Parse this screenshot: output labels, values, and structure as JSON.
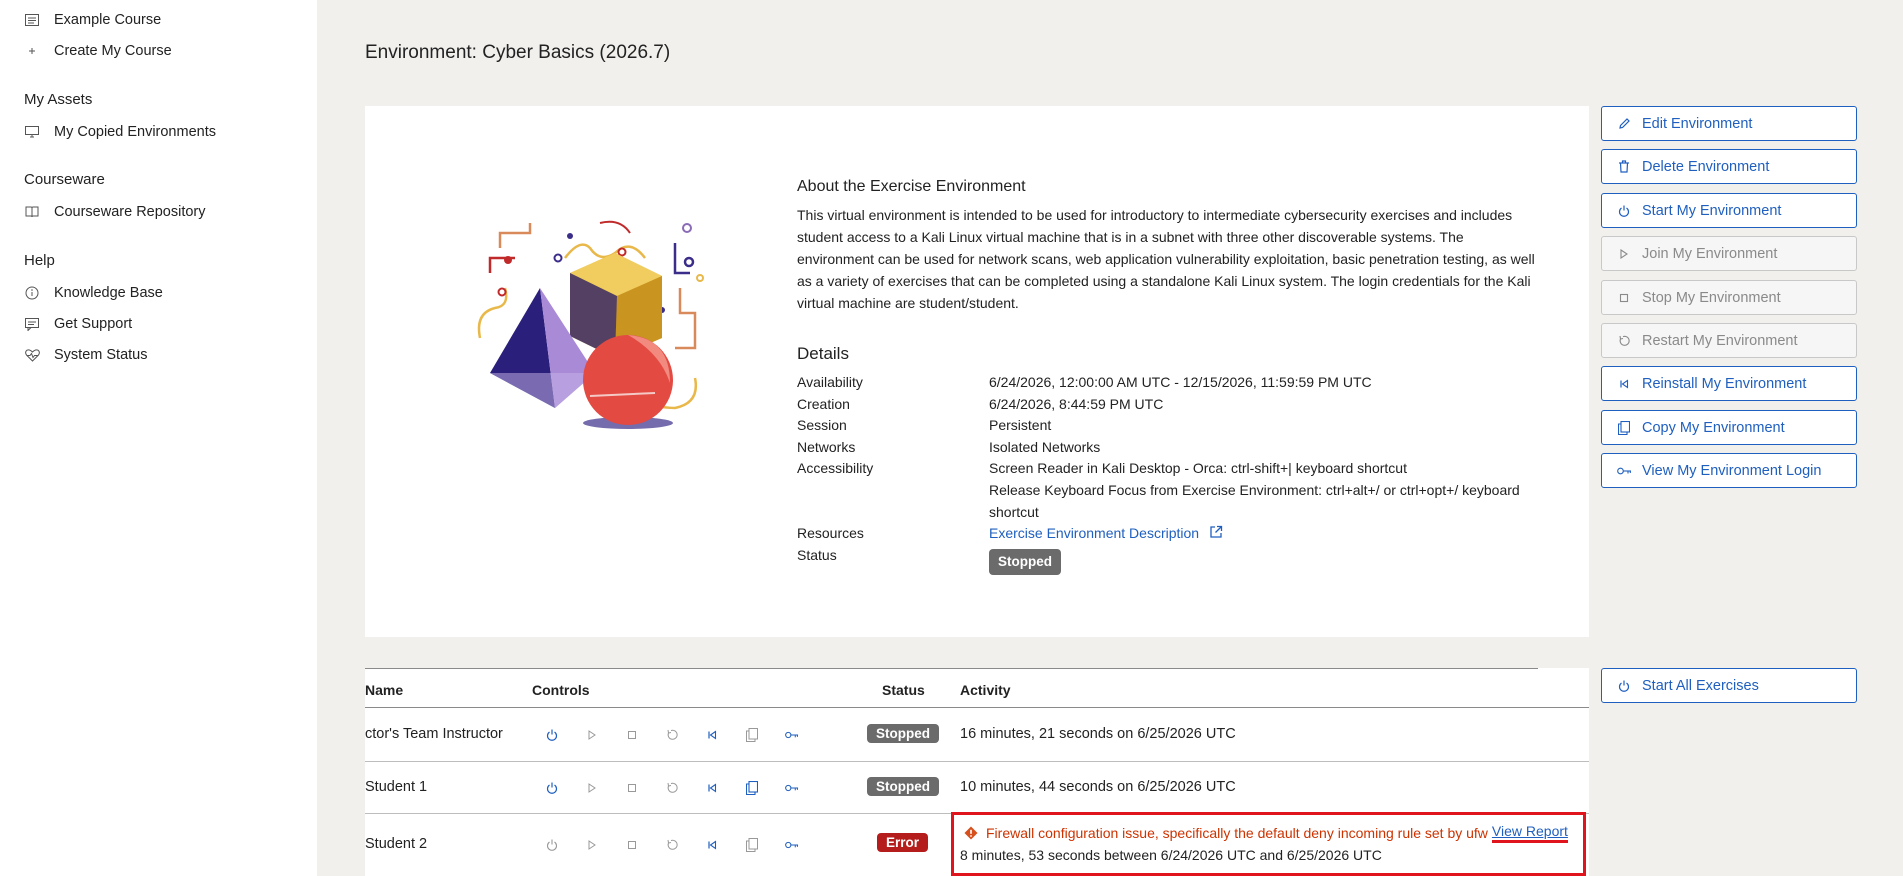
{
  "sidebar": {
    "items_top": [
      {
        "label": "Example Course",
        "icon": "list-icon"
      },
      {
        "label": "Create My Course",
        "icon": "plus-icon"
      }
    ],
    "sections": [
      {
        "heading": "My Assets",
        "items": [
          {
            "label": "My Copied Environments",
            "icon": "monitor-icon"
          }
        ]
      },
      {
        "heading": "Courseware",
        "items": [
          {
            "label": "Courseware Repository",
            "icon": "book-icon"
          }
        ]
      },
      {
        "heading": "Help",
        "items": [
          {
            "label": "Knowledge Base",
            "icon": "info-icon"
          },
          {
            "label": "Get Support",
            "icon": "chat-icon"
          },
          {
            "label": "System Status",
            "icon": "heart-pulse-icon"
          }
        ]
      }
    ]
  },
  "page": {
    "title": "Environment: Cyber Basics (2026.7)"
  },
  "about": {
    "title": "About the Exercise Environment",
    "text": "This virtual environment is intended to be used for introductory to intermediate cybersecurity exercises and includes student access to a Kali Linux virtual machine that is in a subnet with three other discoverable systems. The environment can be used for network scans, web application vulnerability exploitation, basic penetration testing, as well as a variety of exercises that can be completed using a standalone Kali Linux system. The login credentials for the Kali virtual machine are student/student."
  },
  "details": {
    "title": "Details",
    "availability_label": "Availability",
    "availability": "6/24/2026, 12:00:00 AM UTC - 12/15/2026, 11:59:59 PM UTC",
    "creation_label": "Creation",
    "creation": "6/24/2026, 8:44:59 PM UTC",
    "session_label": "Session",
    "session": "Persistent",
    "networks_label": "Networks",
    "networks": "Isolated Networks",
    "accessibility_label": "Accessibility",
    "accessibility_1": "Screen Reader in Kali Desktop - Orca: ctrl-shift+| keyboard shortcut",
    "accessibility_2": "Release Keyboard Focus from Exercise Environment: ctrl+alt+/ or ctrl+opt+/ keyboard shortcut",
    "resources_label": "Resources",
    "resources_link": "Exercise Environment Description",
    "status_label": "Status",
    "status": "Stopped"
  },
  "actions": [
    {
      "label": "Edit Environment",
      "icon": "pencil-icon",
      "enabled": true
    },
    {
      "label": "Delete Environment",
      "icon": "trash-icon",
      "enabled": true
    },
    {
      "label": "Start My Environment",
      "icon": "power-icon",
      "enabled": true
    },
    {
      "label": "Join My Environment",
      "icon": "play-icon",
      "enabled": false
    },
    {
      "label": "Stop My Environment",
      "icon": "stop-icon",
      "enabled": false
    },
    {
      "label": "Restart My Environment",
      "icon": "restart-icon",
      "enabled": false
    },
    {
      "label": "Reinstall My Environment",
      "icon": "skip-back-icon",
      "enabled": true
    },
    {
      "label": "Copy My Environment",
      "icon": "copy-icon",
      "enabled": true
    },
    {
      "label": "View My Environment Login",
      "icon": "key-icon",
      "enabled": true
    }
  ],
  "start_all": {
    "label": "Start All Exercises",
    "icon": "power-icon"
  },
  "table": {
    "headers": {
      "name": "Name",
      "controls": "Controls",
      "status": "Status",
      "activity": "Activity"
    },
    "rows": [
      {
        "name": "ctor's Team Instructor",
        "status": "Stopped",
        "activity": "16 minutes, 21 seconds on 6/25/2026 UTC"
      },
      {
        "name": "Student 1",
        "status": "Stopped",
        "activity": "10 minutes, 44 seconds on 6/25/2026 UTC"
      },
      {
        "name": "Student 2",
        "status": "Error",
        "error_message": "Firewall configuration issue, specifically the default deny incoming rule set by ufw",
        "error_link": "View Report",
        "activity": "8 minutes, 53 seconds between 6/24/2026 UTC and 6/25/2026 UTC"
      }
    ]
  },
  "colors": {
    "accent": "#1f5fbf",
    "error": "#b51d1d",
    "badge": "#6b6b6b",
    "highlight": "#e0141c"
  }
}
